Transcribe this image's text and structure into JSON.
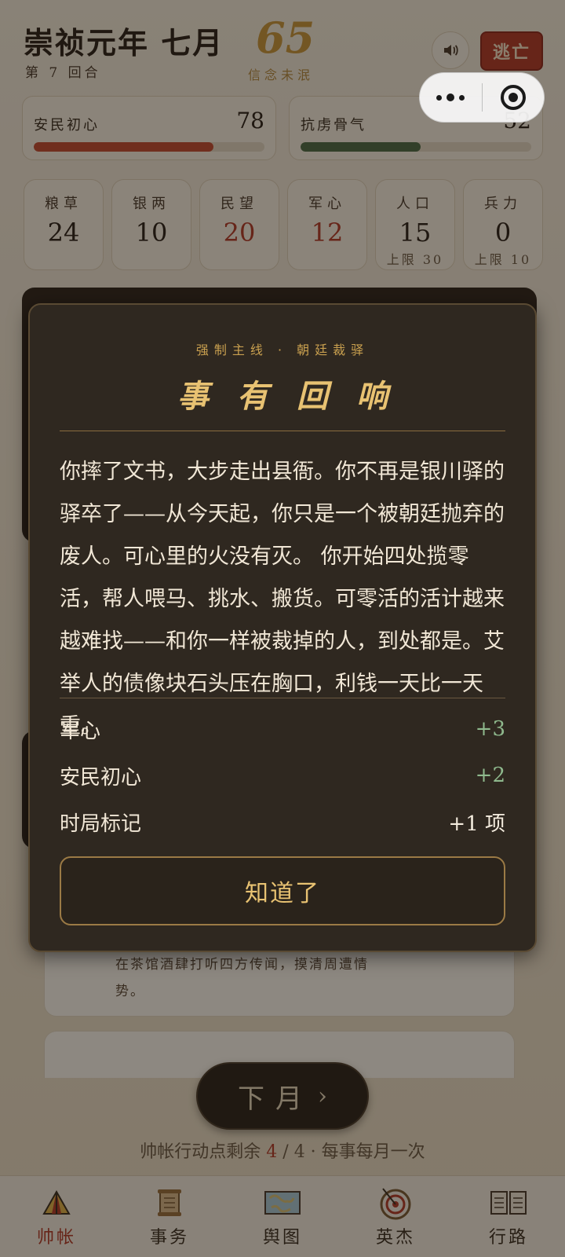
{
  "header": {
    "title": "崇祯元年 七月",
    "round": "第 7 回合",
    "faith_value": "65",
    "faith_label": "信念未泯",
    "flee_label": "逃亡"
  },
  "metrics": [
    {
      "label": "安民初心",
      "value": "78",
      "fill_fraction": 0.78,
      "color": "#c44b33"
    },
    {
      "label": "抗虏骨气",
      "value": "52",
      "fill_fraction": 0.52,
      "color": "#4d6b47"
    }
  ],
  "stats": [
    {
      "label": "粮草",
      "value": "24",
      "cap": ""
    },
    {
      "label": "银两",
      "value": "10",
      "cap": ""
    },
    {
      "label": "民望",
      "value": "20",
      "cap": ""
    },
    {
      "label": "军心",
      "value": "12",
      "cap": ""
    },
    {
      "label": "人口",
      "value": "15",
      "cap": "上限 30"
    },
    {
      "label": "兵力",
      "value": "0",
      "cap": "上限 10"
    }
  ],
  "background_task": {
    "desc": "在茶馆酒肆打听四方传闻，摸清周遭情势。"
  },
  "next_button": {
    "label": "下月",
    "chevron": "›"
  },
  "action_points": {
    "prefix": "帅帐行动点剩余 ",
    "remaining": "4",
    "suffix": " / 4 · 每事每月一次"
  },
  "nav": [
    {
      "label": "帅帐",
      "icon": "tent-icon",
      "active": true
    },
    {
      "label": "事务",
      "icon": "scroll-icon",
      "active": false
    },
    {
      "label": "舆图",
      "icon": "map-icon",
      "active": false
    },
    {
      "label": "英杰",
      "icon": "target-icon",
      "active": false
    },
    {
      "label": "行路",
      "icon": "book-icon",
      "active": false
    }
  ],
  "modal": {
    "kicker": "强制主线 · 朝廷裁驿",
    "title": "事有回响",
    "body": "你摔了文书，大步走出县衙。你不再是银川驿的驿卒了——从今天起，你只是一个被朝廷抛弃的废人。可心里的火没有灭。 你开始四处揽零活，帮人喂马、挑水、搬货。可零活的活计越来越难找——和你一样被裁掉的人，到处都是。艾举人的债像块石头压在胸口，利钱一天比一天重。",
    "effects": [
      {
        "label": "军心",
        "value": "+3",
        "tone": "green"
      },
      {
        "label": "安民初心",
        "value": "+2",
        "tone": "green"
      },
      {
        "label": "时局标记",
        "value": "+1 项",
        "tone": "white"
      }
    ],
    "confirm": "知道了"
  },
  "colors": {
    "accent_gold": "#e8c272",
    "danger_red": "#b23a2a",
    "positive_green": "#8fb98d"
  }
}
